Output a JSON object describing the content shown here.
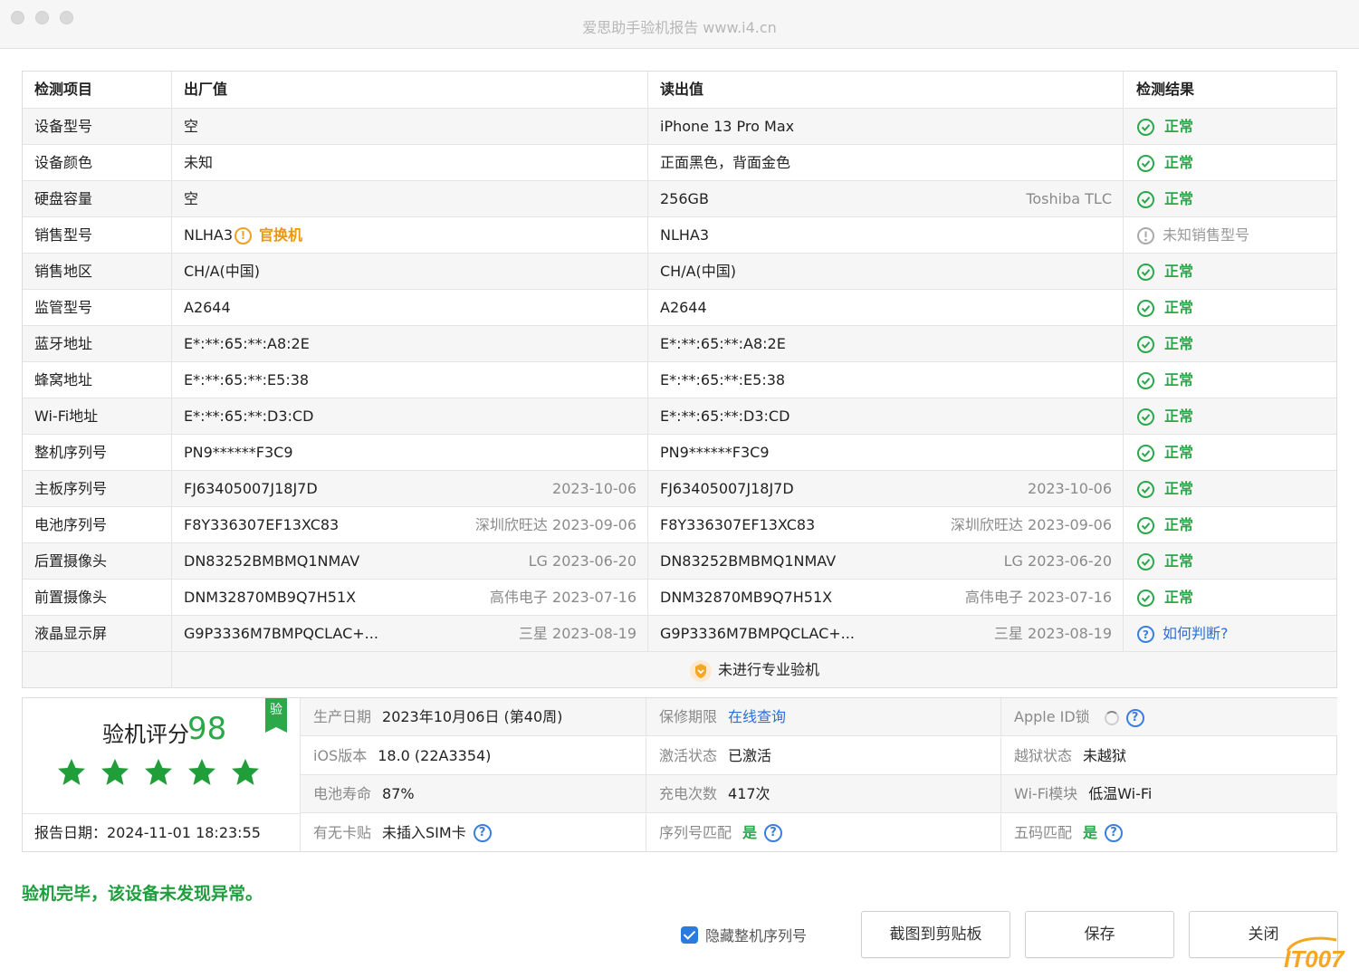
{
  "window": {
    "title": "爱思助手验机报告 www.i4.cn"
  },
  "table": {
    "headers": {
      "item": "检测项目",
      "factory": "出厂值",
      "read": "读出值",
      "result": "检测结果"
    },
    "rows": [
      {
        "item": "设备型号",
        "factory": "空",
        "factory_meta": "",
        "read": "iPhone 13 Pro Max",
        "read_meta": "",
        "result": "正常",
        "status": "ok"
      },
      {
        "item": "设备颜色",
        "factory": "未知",
        "factory_meta": "",
        "read": "正面黑色，背面金色",
        "read_meta": "",
        "result": "正常",
        "status": "ok"
      },
      {
        "item": "硬盘容量",
        "factory": "空",
        "factory_meta": "",
        "read": "256GB",
        "read_meta": "Toshiba TLC",
        "result": "正常",
        "status": "ok"
      },
      {
        "item": "销售型号",
        "factory": "NLHA3",
        "factory_meta": "",
        "factory_tag": "官换机",
        "read": "NLHA3",
        "read_meta": "",
        "result": "未知销售型号",
        "status": "warn"
      },
      {
        "item": "销售地区",
        "factory": "CH/A(中国)",
        "factory_meta": "",
        "read": "CH/A(中国)",
        "read_meta": "",
        "result": "正常",
        "status": "ok"
      },
      {
        "item": "监管型号",
        "factory": "A2644",
        "factory_meta": "",
        "read": "A2644",
        "read_meta": "",
        "result": "正常",
        "status": "ok"
      },
      {
        "item": "蓝牙地址",
        "factory": "E*:**:65:**:A8:2E",
        "factory_meta": "",
        "read": "E*:**:65:**:A8:2E",
        "read_meta": "",
        "result": "正常",
        "status": "ok"
      },
      {
        "item": "蜂窝地址",
        "factory": "E*:**:65:**:E5:38",
        "factory_meta": "",
        "read": "E*:**:65:**:E5:38",
        "read_meta": "",
        "result": "正常",
        "status": "ok"
      },
      {
        "item": "Wi-Fi地址",
        "factory": "E*:**:65:**:D3:CD",
        "factory_meta": "",
        "read": "E*:**:65:**:D3:CD",
        "read_meta": "",
        "result": "正常",
        "status": "ok"
      },
      {
        "item": "整机序列号",
        "factory": "PN9******F3C9",
        "factory_meta": "",
        "read": "PN9******F3C9",
        "read_meta": "",
        "result": "正常",
        "status": "ok"
      },
      {
        "item": "主板序列号",
        "factory": "FJ63405007J18J7D",
        "factory_meta": "2023-10-06",
        "read": "FJ63405007J18J7D",
        "read_meta": "2023-10-06",
        "result": "正常",
        "status": "ok"
      },
      {
        "item": "电池序列号",
        "factory": "F8Y336307EF13XC83",
        "factory_meta": "深圳欣旺达 2023-09-06",
        "read": "F8Y336307EF13XC83",
        "read_meta": "深圳欣旺达 2023-09-06",
        "result": "正常",
        "status": "ok"
      },
      {
        "item": "后置摄像头",
        "factory": "DN83252BMBMQ1NMAV",
        "factory_meta": "LG 2023-06-20",
        "read": "DN83252BMBMQ1NMAV",
        "read_meta": "LG 2023-06-20",
        "result": "正常",
        "status": "ok"
      },
      {
        "item": "前置摄像头",
        "factory": "DNM32870MB9Q7H51X",
        "factory_meta": "高伟电子 2023-07-16",
        "read": "DNM32870MB9Q7H51X",
        "read_meta": "高伟电子 2023-07-16",
        "result": "正常",
        "status": "ok"
      },
      {
        "item": "液晶显示屏",
        "factory": "G9P3336M7BMPQCLAC+...",
        "factory_meta": "三星 2023-08-19",
        "read": "G9P3336M7BMPQCLAC+...",
        "read_meta": "三星 2023-08-19",
        "result": "如何判断?",
        "status": "help"
      }
    ],
    "footer_text": "未进行专业验机"
  },
  "score": {
    "label": "验机评分",
    "value": "98",
    "ribbon": "验",
    "stars": 5,
    "report_date": "报告日期：2024-11-01 18:23:55"
  },
  "info": [
    [
      {
        "label": "生产日期",
        "value": "2023年10月06日 (第40周)",
        "kind": "text"
      },
      {
        "label": "保修期限",
        "value": "在线查询",
        "kind": "link"
      },
      {
        "label": "Apple ID锁",
        "value": "",
        "kind": "spinner"
      }
    ],
    [
      {
        "label": "iOS版本",
        "value": "18.0 (22A3354)",
        "kind": "text"
      },
      {
        "label": "激活状态",
        "value": "已激活",
        "kind": "text"
      },
      {
        "label": "越狱状态",
        "value": "未越狱",
        "kind": "text"
      }
    ],
    [
      {
        "label": "电池寿命",
        "value": "87%",
        "kind": "text"
      },
      {
        "label": "充电次数",
        "value": "417次",
        "kind": "text"
      },
      {
        "label": "Wi-Fi模块",
        "value": "低温Wi-Fi",
        "kind": "text"
      }
    ],
    [
      {
        "label": "有无卡贴",
        "value": "未插入SIM卡",
        "kind": "help"
      },
      {
        "label": "序列号匹配",
        "value": "是",
        "kind": "greenhelp"
      },
      {
        "label": "五码匹配",
        "value": "是",
        "kind": "greenhelp"
      }
    ]
  ],
  "conclusion": "验机完毕，该设备未发现异常。",
  "controls": {
    "hide_serial_label": "隐藏整机序列号",
    "hide_serial_checked": true,
    "screenshot_button": "截图到剪贴板",
    "save_button": "保存",
    "close_button": "关闭"
  },
  "watermark": "IT007",
  "colors": {
    "ok": "#2aa84a",
    "warn_orange": "#f0960a",
    "link": "#2a6fdb"
  }
}
